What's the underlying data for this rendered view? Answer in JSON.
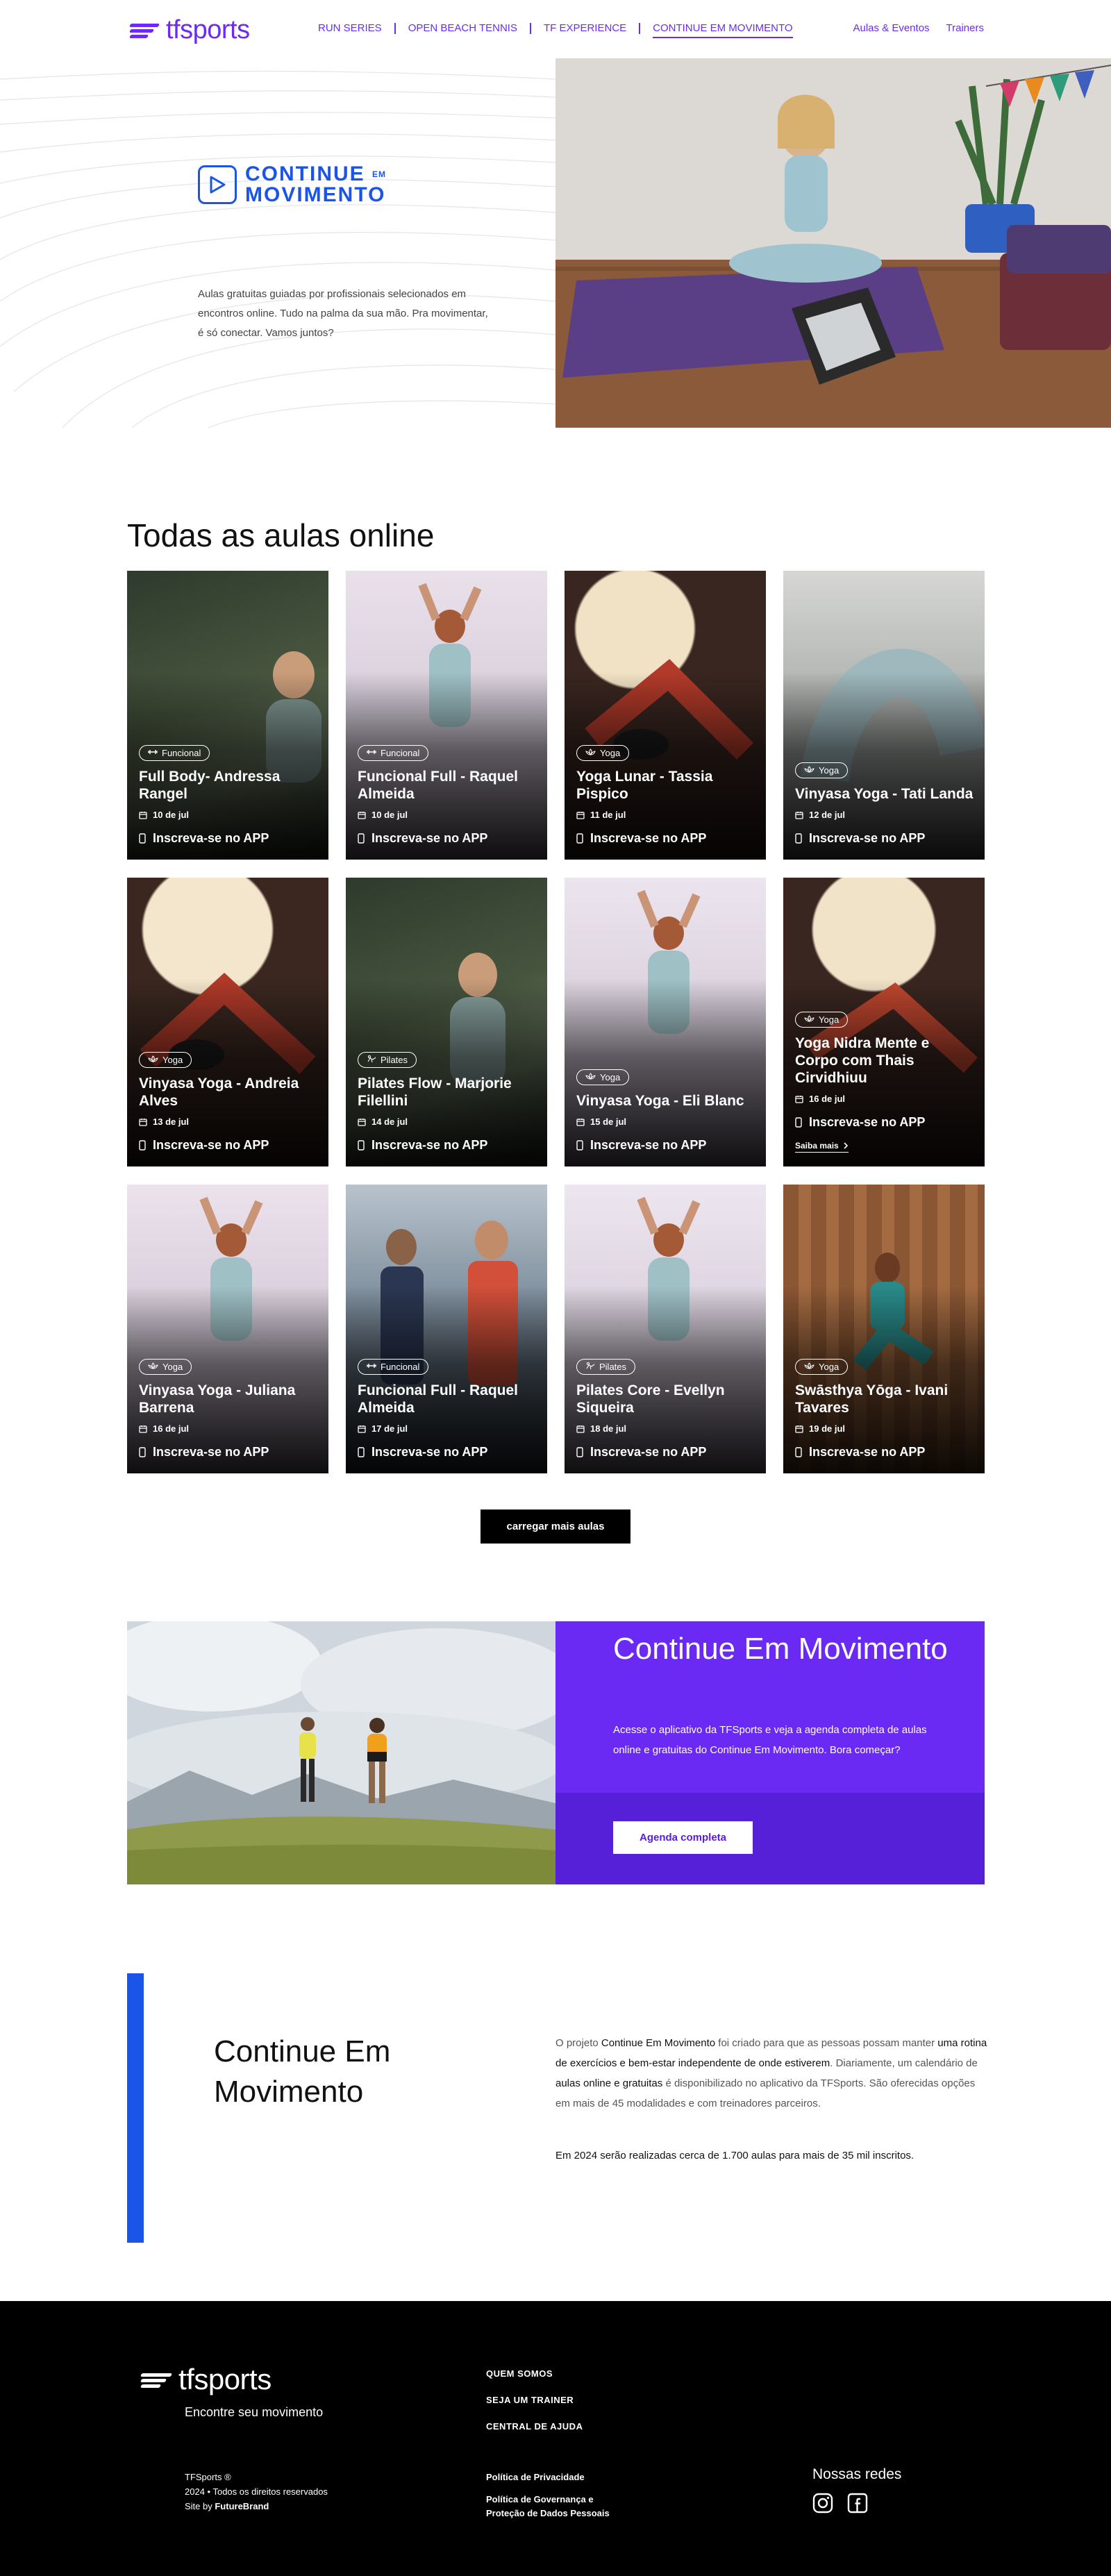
{
  "header": {
    "logo_text": "tfsports",
    "nav": [
      "RUN SERIES",
      "OPEN BEACH TENNIS",
      "TF EXPERIENCE",
      "CONTINUE EM MOVIMENTO"
    ],
    "nav_right": [
      "Aulas & Eventos",
      "Trainers"
    ]
  },
  "hero": {
    "brand_line1": "CONTINUE",
    "brand_small": "EM",
    "brand_line2": "MOVIMENTO",
    "text": "Aulas gratuitas guiadas por profissionais selecionados em encontros online. Tudo na palma da sua mão. Pra movimentar, é só conectar. Vamos juntos?"
  },
  "aulas": {
    "heading": "Todas as aulas online",
    "cta_label": "Inscreva-se no APP",
    "more_label": "Saiba mais",
    "load_more": "carregar mais aulas",
    "cards": [
      {
        "tag": "Funcional",
        "title": "Full Body- Andressa Rangel",
        "date": "10 de jul",
        "icon": "dumbbell-icon"
      },
      {
        "tag": "Funcional",
        "title": "Funcional Full - Raquel Almeida",
        "date": "10 de jul",
        "icon": "dumbbell-icon"
      },
      {
        "tag": "Yoga",
        "title": "Yoga Lunar - Tassia Pispico",
        "date": "11 de jul",
        "icon": "lotus-icon"
      },
      {
        "tag": "Yoga",
        "title": "Vinyasa Yoga - Tati Landa",
        "date": "12 de jul",
        "icon": "lotus-icon"
      },
      {
        "tag": "Yoga",
        "title": "Vinyasa Yoga - Andreia Alves",
        "date": "13 de jul",
        "icon": "lotus-icon"
      },
      {
        "tag": "Pilates",
        "title": "Pilates Flow - Marjorie Filellini",
        "date": "14 de jul",
        "icon": "pilates-icon"
      },
      {
        "tag": "Yoga",
        "title": "Vinyasa Yoga - Eli Blanc",
        "date": "15 de jul",
        "icon": "lotus-icon"
      },
      {
        "tag": "Yoga",
        "title": "Yoga Nidra Mente e Corpo com Thais Cirvidhiuu",
        "date": "16 de jul",
        "icon": "lotus-icon"
      },
      {
        "tag": "Yoga",
        "title": "Vinyasa Yoga - Juliana Barrena",
        "date": "16 de jul",
        "icon": "lotus-icon"
      },
      {
        "tag": "Funcional",
        "title": "Funcional Full - Raquel Almeida",
        "date": "17 de jul",
        "icon": "dumbbell-icon"
      },
      {
        "tag": "Pilates",
        "title": "Pilates Core - Evellyn Siqueira",
        "date": "18 de jul",
        "icon": "pilates-icon"
      },
      {
        "tag": "Yoga",
        "title": "Swāsthya Yōga - Ivani Tavares",
        "date": "19 de jul",
        "icon": "lotus-icon"
      }
    ]
  },
  "promo": {
    "title": "Continue Em Movimento",
    "text": "Acesse o aplicativo da TFSports e veja a agenda completa de aulas online e gratuitas do Continue Em Movimento. Bora começar?",
    "button": "Agenda completa"
  },
  "about": {
    "heading": "Continue Em Movimento",
    "p1_a": "O projeto ",
    "p1_b": "Continue Em Movimento",
    "p1_c": " foi criado para que as pessoas possam manter ",
    "p1_d": "uma rotina de exercícios e bem-estar independente de onde estiverem",
    "p1_e": ". Diariamente, um calendário de ",
    "p1_f": "aulas online e gratuitas",
    "p1_g": " é disponibilizado no aplicativo da TFSports. São oferecidas opções em mais de 45 modalidades e com treinadores parceiros.",
    "p2": "Em 2024 serão realizadas cerca de 1.700 aulas para mais de 35 mil inscritos."
  },
  "footer": {
    "logo_text": "tfsports",
    "tagline": "Encontre seu movimento",
    "links": [
      "QUEM SOMOS",
      "SEJA UM TRAINER",
      "CENTRAL DE AJUDA"
    ],
    "legal1": "TFSports ®",
    "legal2": "2024 • Todos os direitos reservados",
    "legal3_a": "Site by ",
    "legal3_b": "FutureBrand",
    "policy1": "Política de Privacidade",
    "policy2": "Política de Governança e Proteção de Dados Pessoais",
    "social_label": "Nossas redes"
  },
  "colors": {
    "brand_purple": "#6b2bf5",
    "brand_blue": "#1a55e8",
    "footer_bg": "#000000"
  }
}
